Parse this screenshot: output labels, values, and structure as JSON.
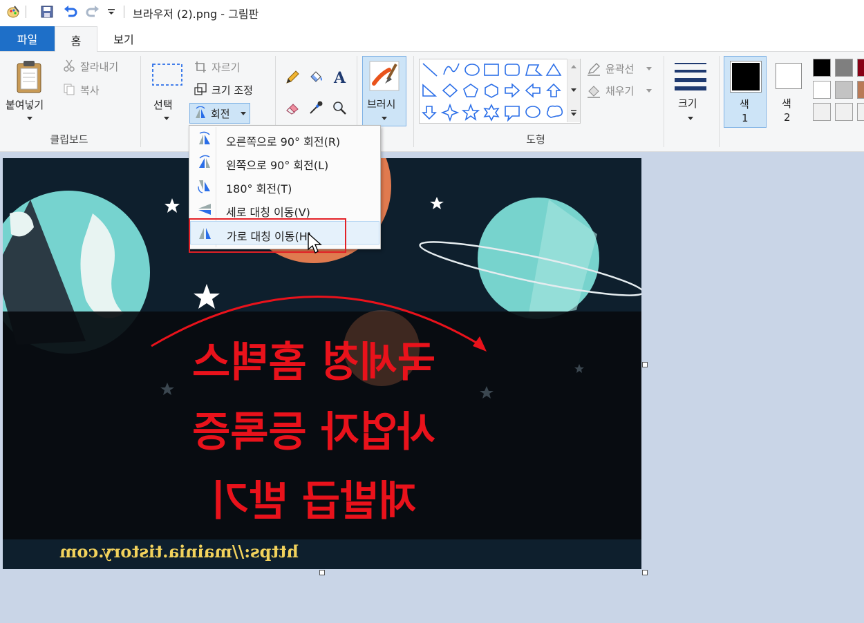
{
  "titlebar": {
    "title": "브라우저 (2).png - 그림판",
    "icons": [
      "paint-app-icon",
      "save-icon",
      "undo-icon",
      "redo-icon",
      "customize-dropdown-icon"
    ]
  },
  "tabs": [
    {
      "label": "파일",
      "active": false
    },
    {
      "label": "홈",
      "active": true
    },
    {
      "label": "보기",
      "active": false
    }
  ],
  "ribbon": {
    "clipboard": {
      "paste": "붙여넣기",
      "cut": "잘라내기",
      "copy": "복사",
      "group": "클립보드"
    },
    "image": {
      "select": "선택",
      "crop": "자르기",
      "resize": "크기 조정",
      "rotate": "회전"
    },
    "tools": {
      "icons": [
        "pencil-icon",
        "fill-icon",
        "text-icon",
        "eraser-icon",
        "color-picker-icon",
        "magnifier-icon"
      ]
    },
    "brushes": {
      "label": "브러시"
    },
    "shapes": {
      "outline": "윤곽선",
      "fill": "채우기",
      "group": "도형"
    },
    "size": {
      "label": "크기"
    },
    "colors": {
      "color1_label": "색",
      "color1_num": "1",
      "color2_label": "색",
      "color2_num": "2",
      "color1": "#000000",
      "color2": "#ffffff",
      "palette": [
        "#000000",
        "#7f7f7f",
        "#880015",
        "#ffffff",
        "#c3c3c3",
        "#b97a57",
        "#f0f0f0",
        "#f0f0f0",
        "#f0f0f0"
      ]
    }
  },
  "rotate_menu": {
    "items": [
      {
        "label": "오른쪽으로 90° 회전(R)"
      },
      {
        "label": "왼쪽으로 90° 회전(L)"
      },
      {
        "label": "180° 회전(T)"
      },
      {
        "label": "세로 대칭 이동(V)"
      },
      {
        "label": "가로 대칭 이동(H)",
        "hovered": true
      }
    ]
  },
  "canvas_image": {
    "headline_lines": [
      "국세청 홈택스",
      "사업자 등록증",
      "재발급 받기"
    ],
    "url": "https://mainia.tistory.com",
    "text_color": "#e9121b",
    "background": "#0e1f2d"
  },
  "accent_colors": {
    "file_tab": "#1e6fc8",
    "highlight_box": "#e32026",
    "workspace": "#c9d5e7"
  }
}
